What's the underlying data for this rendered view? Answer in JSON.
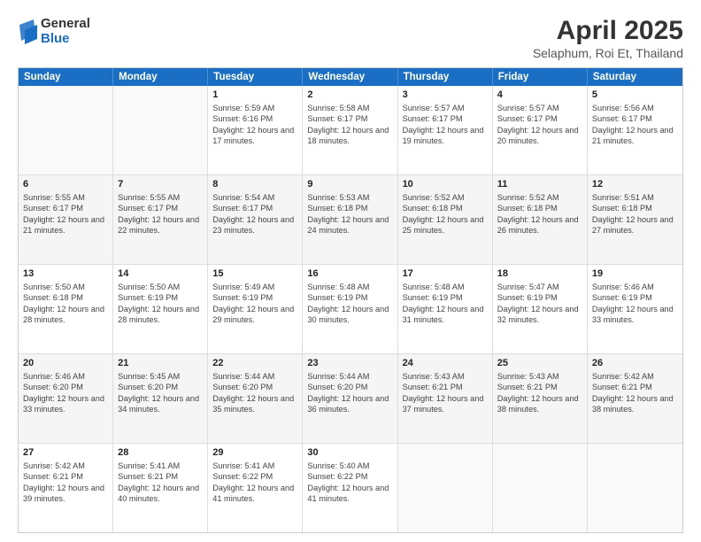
{
  "logo": {
    "general": "General",
    "blue": "Blue"
  },
  "header": {
    "month": "April 2025",
    "location": "Selaphum, Roi Et, Thailand"
  },
  "days_of_week": [
    "Sunday",
    "Monday",
    "Tuesday",
    "Wednesday",
    "Thursday",
    "Friday",
    "Saturday"
  ],
  "weeks": [
    [
      {
        "day": "",
        "sunrise": "",
        "sunset": "",
        "daylight": ""
      },
      {
        "day": "",
        "sunrise": "",
        "sunset": "",
        "daylight": ""
      },
      {
        "day": "1",
        "sunrise": "Sunrise: 5:59 AM",
        "sunset": "Sunset: 6:16 PM",
        "daylight": "Daylight: 12 hours and 17 minutes."
      },
      {
        "day": "2",
        "sunrise": "Sunrise: 5:58 AM",
        "sunset": "Sunset: 6:17 PM",
        "daylight": "Daylight: 12 hours and 18 minutes."
      },
      {
        "day": "3",
        "sunrise": "Sunrise: 5:57 AM",
        "sunset": "Sunset: 6:17 PM",
        "daylight": "Daylight: 12 hours and 19 minutes."
      },
      {
        "day": "4",
        "sunrise": "Sunrise: 5:57 AM",
        "sunset": "Sunset: 6:17 PM",
        "daylight": "Daylight: 12 hours and 20 minutes."
      },
      {
        "day": "5",
        "sunrise": "Sunrise: 5:56 AM",
        "sunset": "Sunset: 6:17 PM",
        "daylight": "Daylight: 12 hours and 21 minutes."
      }
    ],
    [
      {
        "day": "6",
        "sunrise": "Sunrise: 5:55 AM",
        "sunset": "Sunset: 6:17 PM",
        "daylight": "Daylight: 12 hours and 21 minutes."
      },
      {
        "day": "7",
        "sunrise": "Sunrise: 5:55 AM",
        "sunset": "Sunset: 6:17 PM",
        "daylight": "Daylight: 12 hours and 22 minutes."
      },
      {
        "day": "8",
        "sunrise": "Sunrise: 5:54 AM",
        "sunset": "Sunset: 6:17 PM",
        "daylight": "Daylight: 12 hours and 23 minutes."
      },
      {
        "day": "9",
        "sunrise": "Sunrise: 5:53 AM",
        "sunset": "Sunset: 6:18 PM",
        "daylight": "Daylight: 12 hours and 24 minutes."
      },
      {
        "day": "10",
        "sunrise": "Sunrise: 5:52 AM",
        "sunset": "Sunset: 6:18 PM",
        "daylight": "Daylight: 12 hours and 25 minutes."
      },
      {
        "day": "11",
        "sunrise": "Sunrise: 5:52 AM",
        "sunset": "Sunset: 6:18 PM",
        "daylight": "Daylight: 12 hours and 26 minutes."
      },
      {
        "day": "12",
        "sunrise": "Sunrise: 5:51 AM",
        "sunset": "Sunset: 6:18 PM",
        "daylight": "Daylight: 12 hours and 27 minutes."
      }
    ],
    [
      {
        "day": "13",
        "sunrise": "Sunrise: 5:50 AM",
        "sunset": "Sunset: 6:18 PM",
        "daylight": "Daylight: 12 hours and 28 minutes."
      },
      {
        "day": "14",
        "sunrise": "Sunrise: 5:50 AM",
        "sunset": "Sunset: 6:19 PM",
        "daylight": "Daylight: 12 hours and 28 minutes."
      },
      {
        "day": "15",
        "sunrise": "Sunrise: 5:49 AM",
        "sunset": "Sunset: 6:19 PM",
        "daylight": "Daylight: 12 hours and 29 minutes."
      },
      {
        "day": "16",
        "sunrise": "Sunrise: 5:48 AM",
        "sunset": "Sunset: 6:19 PM",
        "daylight": "Daylight: 12 hours and 30 minutes."
      },
      {
        "day": "17",
        "sunrise": "Sunrise: 5:48 AM",
        "sunset": "Sunset: 6:19 PM",
        "daylight": "Daylight: 12 hours and 31 minutes."
      },
      {
        "day": "18",
        "sunrise": "Sunrise: 5:47 AM",
        "sunset": "Sunset: 6:19 PM",
        "daylight": "Daylight: 12 hours and 32 minutes."
      },
      {
        "day": "19",
        "sunrise": "Sunrise: 5:46 AM",
        "sunset": "Sunset: 6:19 PM",
        "daylight": "Daylight: 12 hours and 33 minutes."
      }
    ],
    [
      {
        "day": "20",
        "sunrise": "Sunrise: 5:46 AM",
        "sunset": "Sunset: 6:20 PM",
        "daylight": "Daylight: 12 hours and 33 minutes."
      },
      {
        "day": "21",
        "sunrise": "Sunrise: 5:45 AM",
        "sunset": "Sunset: 6:20 PM",
        "daylight": "Daylight: 12 hours and 34 minutes."
      },
      {
        "day": "22",
        "sunrise": "Sunrise: 5:44 AM",
        "sunset": "Sunset: 6:20 PM",
        "daylight": "Daylight: 12 hours and 35 minutes."
      },
      {
        "day": "23",
        "sunrise": "Sunrise: 5:44 AM",
        "sunset": "Sunset: 6:20 PM",
        "daylight": "Daylight: 12 hours and 36 minutes."
      },
      {
        "day": "24",
        "sunrise": "Sunrise: 5:43 AM",
        "sunset": "Sunset: 6:21 PM",
        "daylight": "Daylight: 12 hours and 37 minutes."
      },
      {
        "day": "25",
        "sunrise": "Sunrise: 5:43 AM",
        "sunset": "Sunset: 6:21 PM",
        "daylight": "Daylight: 12 hours and 38 minutes."
      },
      {
        "day": "26",
        "sunrise": "Sunrise: 5:42 AM",
        "sunset": "Sunset: 6:21 PM",
        "daylight": "Daylight: 12 hours and 38 minutes."
      }
    ],
    [
      {
        "day": "27",
        "sunrise": "Sunrise: 5:42 AM",
        "sunset": "Sunset: 6:21 PM",
        "daylight": "Daylight: 12 hours and 39 minutes."
      },
      {
        "day": "28",
        "sunrise": "Sunrise: 5:41 AM",
        "sunset": "Sunset: 6:21 PM",
        "daylight": "Daylight: 12 hours and 40 minutes."
      },
      {
        "day": "29",
        "sunrise": "Sunrise: 5:41 AM",
        "sunset": "Sunset: 6:22 PM",
        "daylight": "Daylight: 12 hours and 41 minutes."
      },
      {
        "day": "30",
        "sunrise": "Sunrise: 5:40 AM",
        "sunset": "Sunset: 6:22 PM",
        "daylight": "Daylight: 12 hours and 41 minutes."
      },
      {
        "day": "",
        "sunrise": "",
        "sunset": "",
        "daylight": ""
      },
      {
        "day": "",
        "sunrise": "",
        "sunset": "",
        "daylight": ""
      },
      {
        "day": "",
        "sunrise": "",
        "sunset": "",
        "daylight": ""
      }
    ]
  ]
}
